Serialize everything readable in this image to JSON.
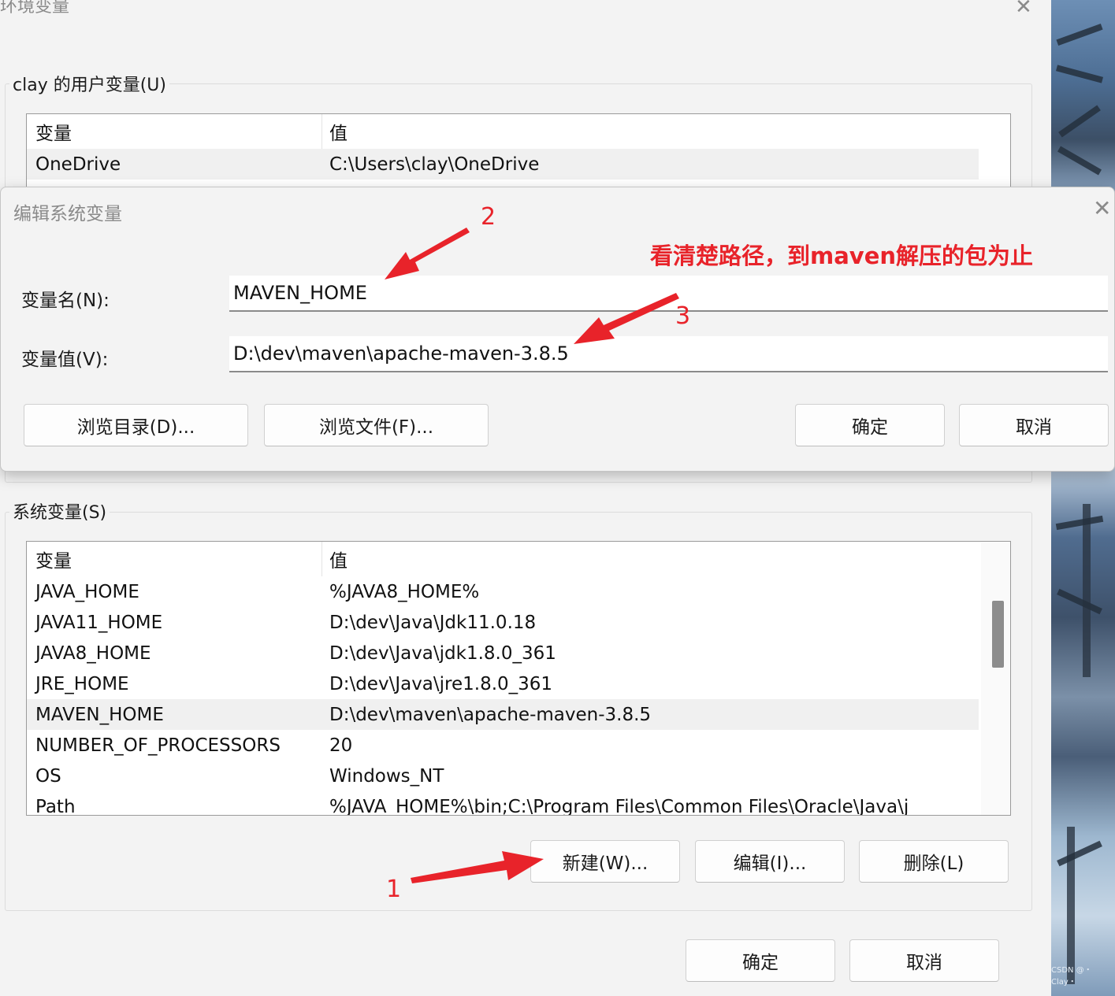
{
  "main_window": {
    "title": "环境变量",
    "close_icon": "close-icon",
    "user_group": {
      "label": "clay 的用户变量(U)",
      "col_variable": "变量",
      "col_value": "值",
      "rows": [
        {
          "name": "OneDrive",
          "value": "C:\\Users\\clay\\OneDrive"
        }
      ]
    },
    "system_group": {
      "label": "系统变量(S)",
      "col_variable": "变量",
      "col_value": "值",
      "rows": [
        {
          "name": "JAVA_HOME",
          "value": "%JAVA8_HOME%"
        },
        {
          "name": "JAVA11_HOME",
          "value": "D:\\dev\\Java\\Jdk11.0.18"
        },
        {
          "name": "JAVA8_HOME",
          "value": "D:\\dev\\Java\\jdk1.8.0_361"
        },
        {
          "name": "JRE_HOME",
          "value": "D:\\dev\\Java\\jre1.8.0_361"
        },
        {
          "name": "MAVEN_HOME",
          "value": "D:\\dev\\maven\\apache-maven-3.8.5"
        },
        {
          "name": "NUMBER_OF_PROCESSORS",
          "value": "20"
        },
        {
          "name": "OS",
          "value": "Windows_NT"
        },
        {
          "name": "Path",
          "value": "%JAVA_HOME%\\bin;C:\\Program Files\\Common Files\\Oracle\\Java\\j"
        }
      ],
      "buttons": {
        "new": "新建(W)...",
        "edit": "编辑(I)...",
        "delete": "删除(L)"
      }
    },
    "ok": "确定",
    "cancel": "取消"
  },
  "edit_dialog": {
    "title": "编辑系统变量",
    "name_label": "变量名(N):",
    "name_value": "MAVEN_HOME",
    "value_label": "变量值(V):",
    "value_value": "D:\\dev\\maven\\apache-maven-3.8.5",
    "browse_dir": "浏览目录(D)...",
    "browse_file": "浏览文件(F)...",
    "ok": "确定",
    "cancel": "取消"
  },
  "annotations": {
    "step1": "1",
    "step2": "2",
    "step3": "3",
    "note": "看清楚路径，到maven解压的包为止",
    "color": "#e8232a"
  },
  "watermark": "CSDN @・Clay・"
}
